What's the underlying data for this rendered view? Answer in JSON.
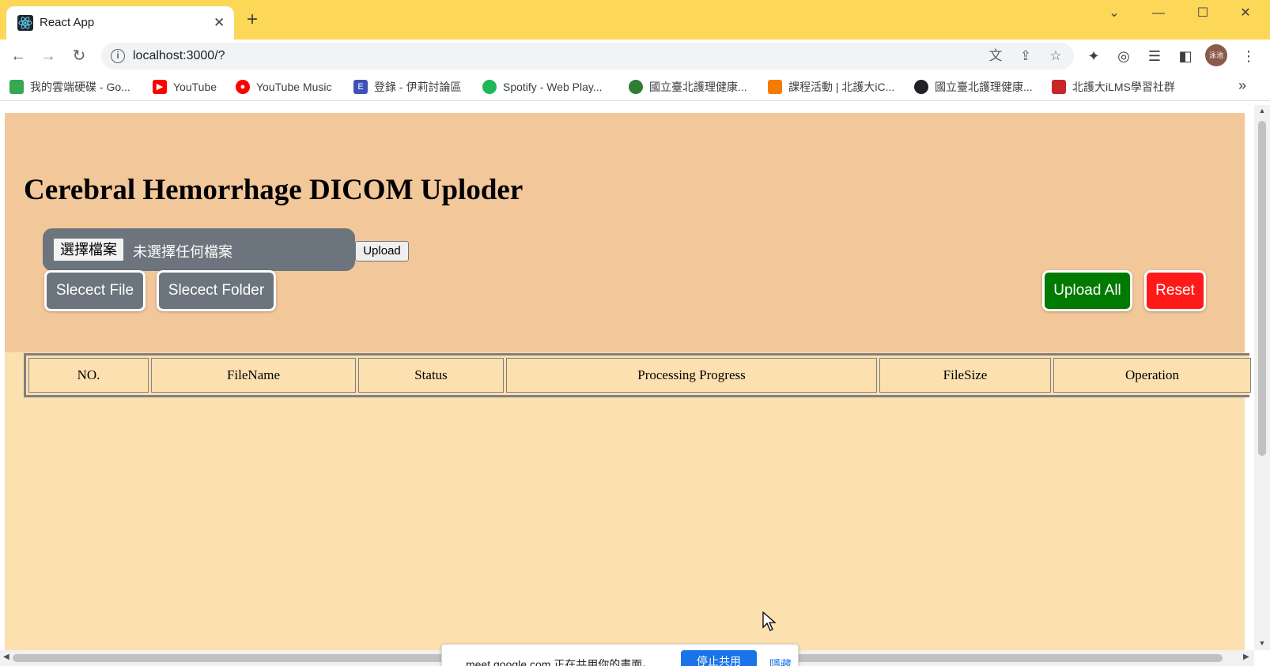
{
  "browser": {
    "tab_title": "React App",
    "url": "localhost:3000/?",
    "bookmarks": [
      {
        "label": "我的雲端硬碟 - Go...",
        "color": "#34a853"
      },
      {
        "label": "YouTube",
        "color": "#ff0000"
      },
      {
        "label": "YouTube Music",
        "color": "#ff0000"
      },
      {
        "label": "登錄 - 伊莉討論區",
        "color": "#3f51b5"
      },
      {
        "label": "Spotify - Web Play...",
        "color": "#1db954"
      },
      {
        "label": "國立臺北護理健康...",
        "color": "#2e7d32"
      },
      {
        "label": "課程活動 | 北護大iC...",
        "color": "#f57c00"
      },
      {
        "label": "國立臺北護理健康...",
        "color": "#202124"
      },
      {
        "label": "北護大iLMS學習社群",
        "color": "#c62828"
      }
    ],
    "avatar_text": "泳池"
  },
  "page": {
    "title": "Cerebral Hemorrhage DICOM Uploder",
    "file_input": {
      "choose_label": "選擇檔案",
      "no_file_text": "未選擇任何檔案"
    },
    "upload_label": "Upload",
    "select_file_label": "Slecect File",
    "select_folder_label": "Slecect Folder",
    "upload_all_label": "Upload All",
    "reset_label": "Reset",
    "table": {
      "headers": [
        "NO.",
        "FileName",
        "Status",
        "Processing Progress",
        "FileSize",
        "Operation"
      ]
    }
  },
  "share_notice": {
    "text": "meet.google.com 正在共用你的畫面。",
    "stop_label": "停止共用",
    "hide_label": "隱藏"
  },
  "colors": {
    "header_bg": "#f2c79a",
    "page_bg": "#fde0b0",
    "select_buttons": "#6c757d",
    "upload_all": "#007a00",
    "reset": "#ff1a1a",
    "browser_frame": "#fcd758"
  }
}
